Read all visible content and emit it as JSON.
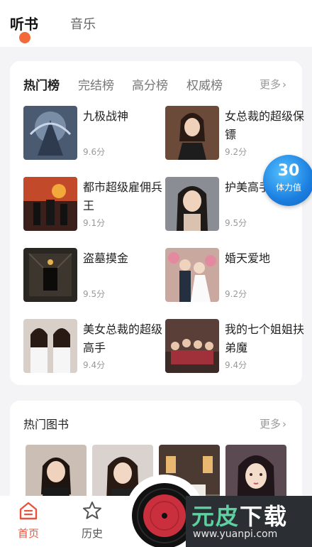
{
  "top_tabs": {
    "active": "听书",
    "inactive": "音乐"
  },
  "ranking": {
    "tabs": [
      "热门榜",
      "完结榜",
      "高分榜",
      "权威榜"
    ],
    "more": "更多",
    "items": [
      {
        "title": "九极战神",
        "score": "9.6分"
      },
      {
        "title": "女总裁的超级保镖",
        "score": "9.2分"
      },
      {
        "title": "都市超级雇佣兵王",
        "score": "9.1分"
      },
      {
        "title": "护美高手",
        "score": "9.5分"
      },
      {
        "title": "盗墓摸金",
        "score": "9.5分"
      },
      {
        "title": "婚天爱地",
        "score": "9.2分"
      },
      {
        "title": "美女总裁的超级高手",
        "score": "9.4分"
      },
      {
        "title": "我的七个姐姐扶弟魔",
        "score": "9.4分"
      }
    ]
  },
  "hot_books": {
    "title": "热门图书",
    "more": "更多"
  },
  "energy": {
    "value": "30",
    "label": "体力值"
  },
  "nav": {
    "home": "首页",
    "history": "历史"
  },
  "watermark": {
    "brand_a": "元",
    "brand_b": "皮",
    "brand_c": "下载",
    "url": "www.yuanpi.com"
  },
  "colors": {
    "accent": "#e8553f",
    "dot": "#f26a3a",
    "energy": "#1b7fe0"
  }
}
